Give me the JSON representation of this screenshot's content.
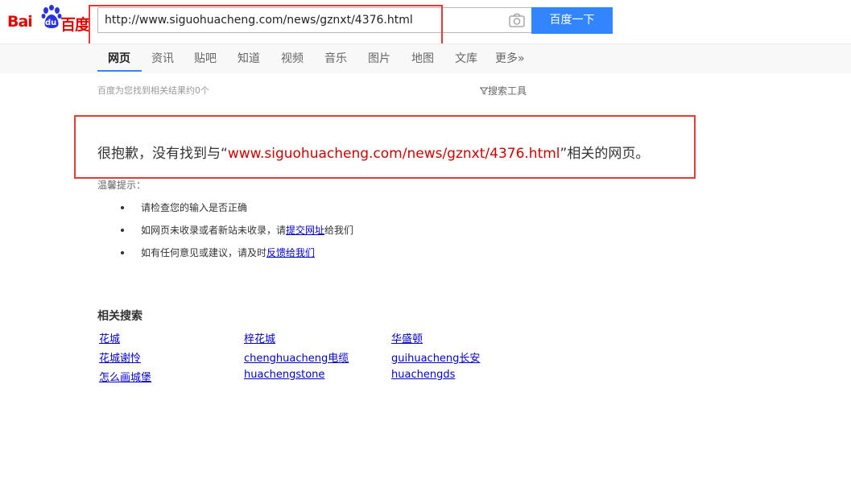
{
  "logo": {
    "bai": "Bai",
    "du": "du",
    "cn": "百度"
  },
  "search": {
    "query": "http://www.siguohuacheng.com/news/gznxt/4376.html",
    "button": "百度一下"
  },
  "tabs": [
    "网页",
    "资讯",
    "贴吧",
    "知道",
    "视频",
    "音乐",
    "图片",
    "地图",
    "文库",
    "更多»"
  ],
  "stats": "百度为您找到相关结果约0个",
  "tools": {
    "icon": "funnel-icon",
    "label": "搜索工具"
  },
  "no_result": {
    "prefix": "很抱歉，没有找到与“",
    "keyword": "www.siguohuacheng.com/news/gznxt/4376.html",
    "suffix": "”相关的网页。"
  },
  "tips": {
    "title": "温馨提示：",
    "items": [
      {
        "text": "请检查您的输入是否正确"
      },
      {
        "before": "如网页未收录或者新站未收录，请",
        "link": "提交网址",
        "after": "给我们"
      },
      {
        "before": "如有任何意见或建议，请及时",
        "link": "反馈给我们"
      }
    ]
  },
  "related": {
    "title": "相关搜索",
    "items": [
      "花城",
      "梓花城",
      "华盛顿",
      "花城谢怜",
      "chenghuacheng电缆",
      "guihuacheng长安",
      "怎么画城堡",
      "huachengstone",
      "huachengds"
    ]
  },
  "colors": {
    "accent": "#3385ff",
    "brand": "#e10602",
    "highlight": "#e53935",
    "link": "#0000cc"
  }
}
